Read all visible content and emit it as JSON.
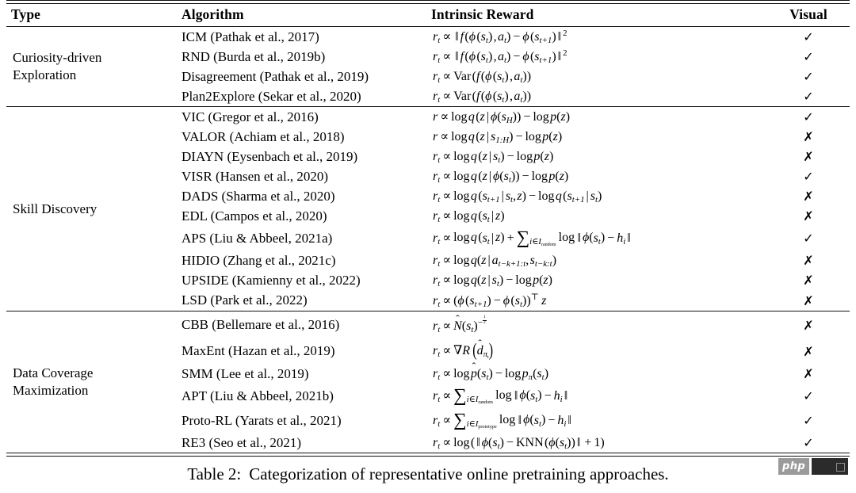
{
  "table": {
    "number": "Table 2:",
    "caption": "Categorization of representative online pretraining approaches.",
    "columns": [
      "Type",
      "Algorithm",
      "Intrinsic Reward",
      "Visual"
    ],
    "sections": [
      {
        "type": "Curiosity-driven Exploration",
        "type_lines": [
          "Curiosity-driven",
          "Exploration"
        ],
        "rows": [
          {
            "algorithm": "ICM (Pathak et al., 2017)",
            "reward": "r_t ∝ ||f (φ (s_t) , a_t) − φ (s_{t+1})||^2",
            "visual": "✓"
          },
          {
            "algorithm": "RND (Burda et al., 2019b)",
            "reward": "r_t ∝ ||f (φ (s_t) , a_t) − φ (s_{t+1})||^2",
            "visual": "✓"
          },
          {
            "algorithm": "Disagreement (Pathak et al., 2019)",
            "reward": "r_t ∝ Var (f (φ (s_t) , a_t))",
            "visual": "✓"
          },
          {
            "algorithm": "Plan2Explore (Sekar et al., 2020)",
            "reward": "r_t ∝ Var (f (φ (s_t) , a_t))",
            "visual": "✓"
          }
        ]
      },
      {
        "type": "Skill Discovery",
        "type_lines": [
          "Skill Discovery"
        ],
        "rows": [
          {
            "algorithm": "VIC (Gregor et al., 2016)",
            "reward": "r ∝ log q (z | φ(s_H)) − log p(z)",
            "visual": "✓"
          },
          {
            "algorithm": "VALOR (Achiam et al., 2018)",
            "reward": "r ∝ log q (z | s_{1:H}) − log p(z)",
            "visual": "✗"
          },
          {
            "algorithm": "DIAYN (Eysenbach et al., 2019)",
            "reward": "r_t ∝ log q (z | s_t) − log p(z)",
            "visual": "✗"
          },
          {
            "algorithm": "VISR (Hansen et al., 2020)",
            "reward": "r_t ∝ log q (z | φ(s_t)) − log p(z)",
            "visual": "✓"
          },
          {
            "algorithm": "DADS (Sharma et al., 2020)",
            "reward": "r_t ∝ log q (s_{t+1} | s_t, z) − log q (s_{t+1} | s_t)",
            "visual": "✗"
          },
          {
            "algorithm": "EDL (Campos et al., 2020)",
            "reward": "r_t ∝ log q (s_t | z)",
            "visual": "✗"
          },
          {
            "algorithm": "APS (Liu & Abbeel, 2021a)",
            "reward": "r_t ∝ log q (s_t | z) + Σ_{i∈I_random} log ||φ(s_t) − h_i||",
            "visual": "✓"
          },
          {
            "algorithm": "HIDIO (Zhang et al., 2021c)",
            "reward": "r_t ∝ log q(z | a_{t−k+1:t}, s_{t−k:t})",
            "visual": "✗"
          },
          {
            "algorithm": "UPSIDE (Kamienny et al., 2022)",
            "reward": "r_t ∝ log q(z | s_t) − log p(z)",
            "visual": "✗"
          },
          {
            "algorithm": "LSD (Park et al., 2022)",
            "reward": "r_t ∝ (φ (s_{t+1}) − φ (s_t))^⊤ z",
            "visual": "✗"
          }
        ]
      },
      {
        "type": "Data Coverage Maximization",
        "type_lines": [
          "Data Coverage",
          "Maximization"
        ],
        "rows": [
          {
            "algorithm": "CBB (Bellemare et al., 2016)",
            "reward": "r_t ∝ N̂(s_t)^{−1/2}",
            "visual": "✗"
          },
          {
            "algorithm": "MaxEnt (Hazan et al., 2019)",
            "reward": "r_t ∝ ∇R (d̂_{π_t})",
            "visual": "✗"
          },
          {
            "algorithm": "SMM (Lee et al., 2019)",
            "reward": "r_t ∝ log p̂(s_t) − log p_π(s_t)",
            "visual": "✗"
          },
          {
            "algorithm": "APT (Liu & Abbeel, 2021b)",
            "reward": "r_t ∝ Σ_{i∈I_random} log ||φ(s_t) − h_i||",
            "visual": "✓"
          },
          {
            "algorithm": "Proto-RL (Yarats et al., 2021)",
            "reward": "r_t ∝ Σ_{i∈I_prototype} log ||φ(s_t) − h_i||",
            "visual": "✓"
          },
          {
            "algorithm": "RE3 (Seo et al., 2021)",
            "reward": "r_t ∝ log (||φ(s_t) − KNN (φ(s_t))|| + 1)",
            "visual": "✓"
          }
        ]
      }
    ]
  },
  "watermark": {
    "label": "php"
  }
}
